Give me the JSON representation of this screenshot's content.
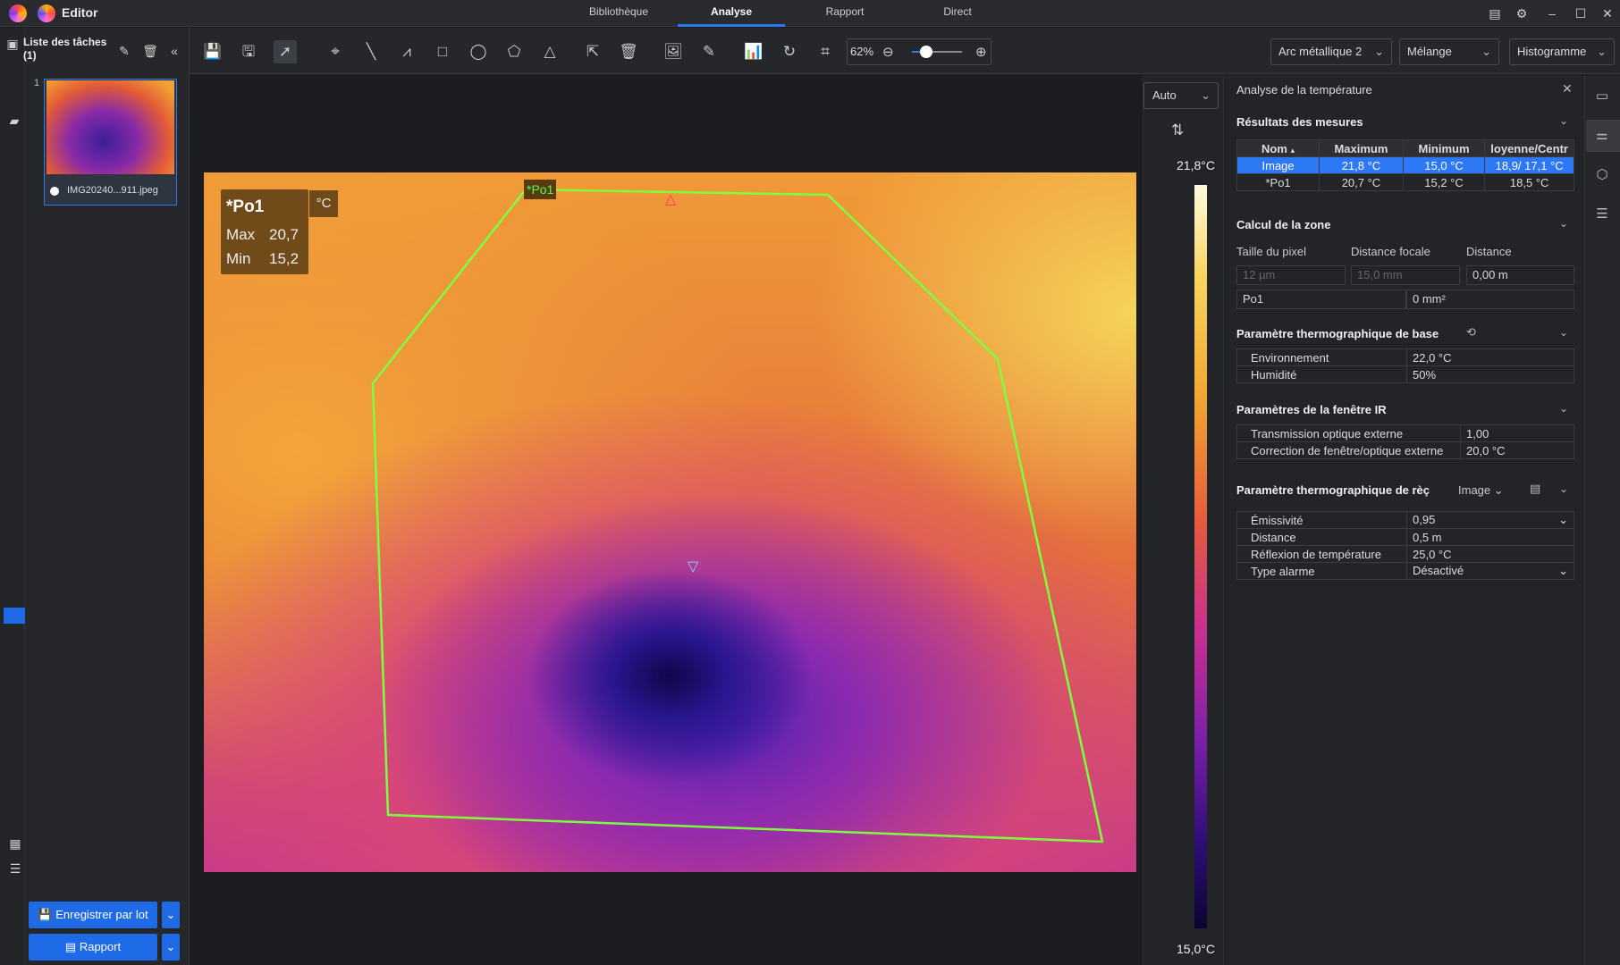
{
  "app": {
    "title": "Editor"
  },
  "nav": {
    "tabs": [
      {
        "label": "Bibliothèque"
      },
      {
        "label": "Analyse"
      },
      {
        "label": "Rapport"
      },
      {
        "label": "Direct"
      }
    ]
  },
  "tasks": {
    "title": "Liste des tâches",
    "count": "(1)",
    "item_index": "1",
    "file_name": "IMG20240...911.jpeg"
  },
  "buttons": {
    "batch_save": "Enregistrer par lot",
    "report": "Rapport"
  },
  "toolbar": {
    "zoom": "62%",
    "palette": "Arc métallique 2",
    "blend": "Mélange",
    "histogram": "Histogramme"
  },
  "image": {
    "roi_label": "*Po1",
    "info": {
      "name": "*Po1",
      "max_label": "Max",
      "max_value": "20,7",
      "min_label": "Min",
      "min_value": "15,2",
      "unit": "°C"
    },
    "scale": {
      "mode": "Auto",
      "max": "21,8°C",
      "min": "15,0°C"
    }
  },
  "panel": {
    "title": "Analyse de la température",
    "results": {
      "title": "Résultats des mesures",
      "headers": [
        "Nom",
        "Maximum",
        "Minimum",
        "loyenne/Centr"
      ],
      "rows": [
        [
          "Image",
          "21,8 °C",
          "15,0 °C",
          "18,9/ 17,1 °C"
        ],
        [
          "*Po1",
          "20,7 °C",
          "15,2 °C",
          "18,5 °C"
        ]
      ]
    },
    "zone": {
      "title": "Calcul de la zone",
      "labels": [
        "Taille du pixel",
        "Distance focale",
        "Distance"
      ],
      "values": [
        "12 µm",
        "15,0 mm",
        "0,00 m"
      ],
      "row_name": "Po1",
      "row_value": "0 mm²"
    },
    "basic": {
      "title": "Paramètre thermographique de base",
      "rows": [
        [
          "Environnement",
          "22,0 °C"
        ],
        [
          "Humidité",
          "50%"
        ]
      ]
    },
    "ir": {
      "title": "Paramètres de la fenêtre IR",
      "rows": [
        [
          "Transmission optique externe",
          "1,00"
        ],
        [
          "Correction de fenêtre/optique externe",
          "20,0 °C"
        ]
      ]
    },
    "reg": {
      "title": "Paramètre thermographique de rèç",
      "target": "Image",
      "rows": [
        [
          "Émissivité",
          "0,95"
        ],
        [
          "Distance",
          "0,5 m"
        ],
        [
          "Réflexion de température",
          "25,0 °C"
        ],
        [
          "Type alarme",
          "Désactivé"
        ]
      ]
    }
  }
}
